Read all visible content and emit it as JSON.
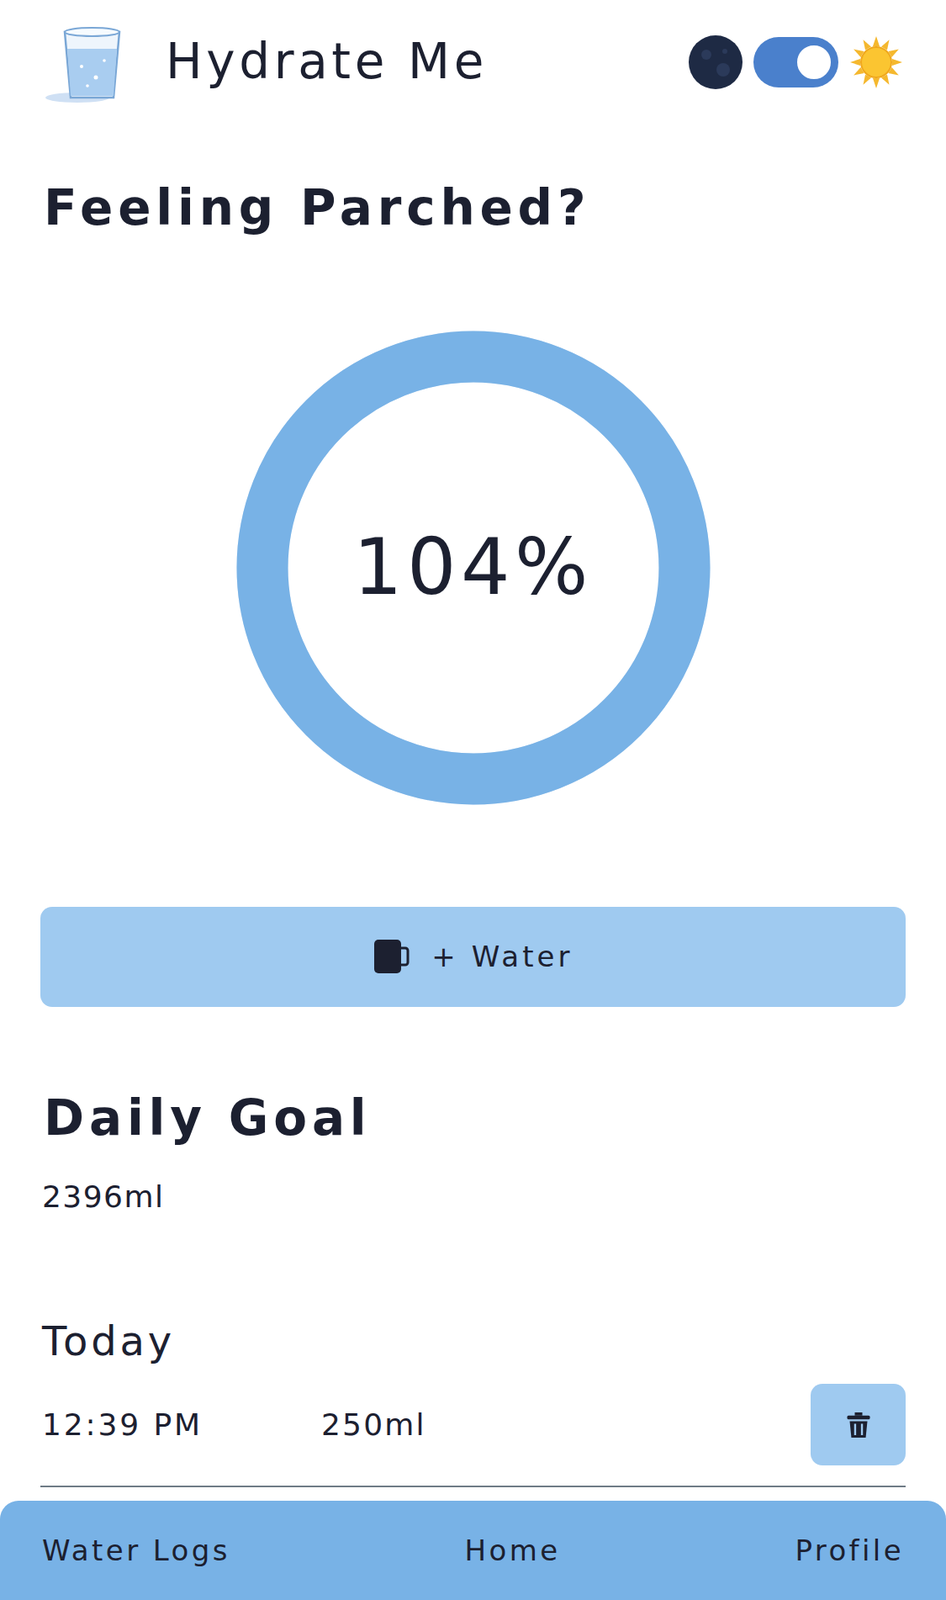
{
  "header": {
    "title": "Hydrate Me",
    "theme_toggle": {
      "on": true
    }
  },
  "prompt": "Feeling Parched?",
  "progress": {
    "reading": "104%",
    "level": 1
  },
  "add_button": {
    "label": "+ Water"
  },
  "daily_goal": {
    "title": "Daily Goal",
    "value": "2396ml"
  },
  "today": {
    "title": "Today",
    "entries": [
      {
        "time": "12:39 PM",
        "amount": "250ml"
      }
    ]
  },
  "nav": [
    {
      "label": "Water Logs"
    },
    {
      "label": "Home"
    },
    {
      "label": "Profile"
    }
  ]
}
